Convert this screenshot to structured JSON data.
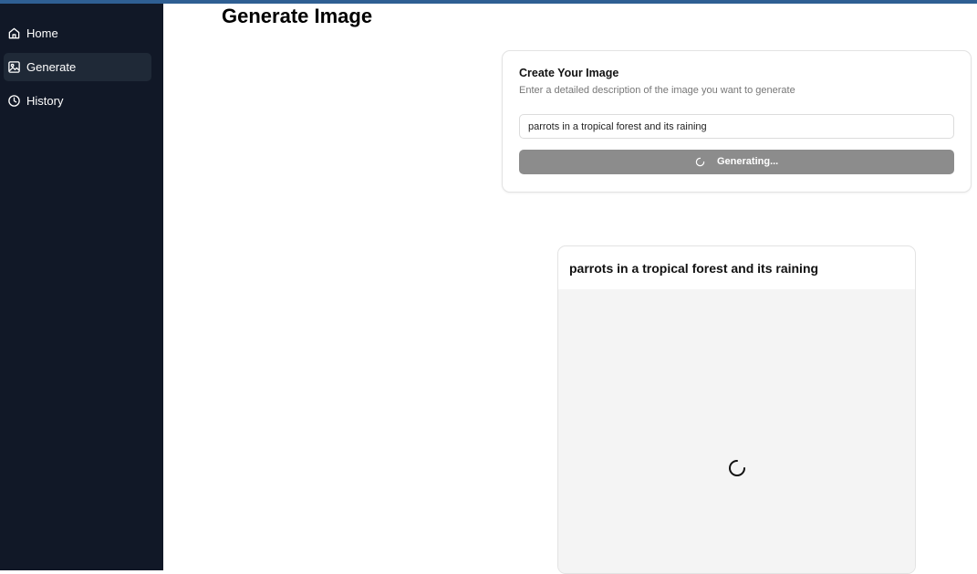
{
  "sidebar": {
    "items": [
      {
        "label": "Home",
        "icon": "home-icon",
        "active": false
      },
      {
        "label": "Generate",
        "icon": "image-icon",
        "active": true
      },
      {
        "label": "History",
        "icon": "clock-icon",
        "active": false
      }
    ]
  },
  "main": {
    "title": "Generate Image"
  },
  "form": {
    "title": "Create Your Image",
    "description": "Enter a detailed description of the image you want to generate",
    "prompt_value": "parrots in a tropical forest and its raining",
    "button_label": "Generating...",
    "button_icon": "spinner-icon"
  },
  "result": {
    "title": "parrots in a tropical forest and its raining",
    "status_icon": "loading-spinner-icon"
  },
  "colors": {
    "sidebar_bg": "#111827",
    "active_item_bg": "#1f2937",
    "top_accent": "#2f5f93",
    "button_disabled_bg": "#8c8c8c",
    "image_placeholder_bg": "#f4f4f4"
  }
}
